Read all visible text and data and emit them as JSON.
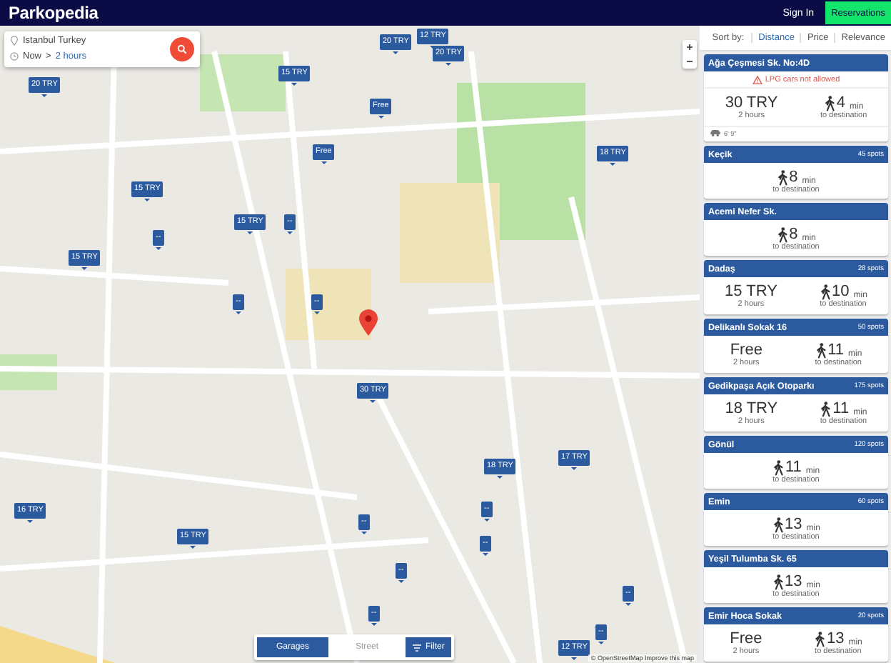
{
  "header": {
    "logo": "Parkopedia",
    "sign_in": "Sign In",
    "reservations": "Reservations"
  },
  "search": {
    "location": "Istanbul Turkey",
    "time": "Now",
    "separator": ">",
    "duration": "2 hours"
  },
  "map_pins": [
    {
      "label": "20 TRY"
    },
    {
      "label": "15 TRY"
    },
    {
      "label": "20 TRY"
    },
    {
      "label": "12 TRY"
    },
    {
      "label": "20 TRY"
    },
    {
      "label": "Free"
    },
    {
      "label": "Free"
    },
    {
      "label": "18 TRY"
    },
    {
      "label": "15 TRY"
    },
    {
      "label": "--"
    },
    {
      "label": "15 TRY"
    },
    {
      "label": "--"
    },
    {
      "label": "15 TRY"
    },
    {
      "label": "--"
    },
    {
      "label": "--"
    },
    {
      "label": "30 TRY"
    },
    {
      "label": "18 TRY"
    },
    {
      "label": "17 TRY"
    },
    {
      "label": "16 TRY"
    },
    {
      "label": "--"
    },
    {
      "label": "--"
    },
    {
      "label": "15 TRY"
    },
    {
      "label": "--"
    },
    {
      "label": "--"
    },
    {
      "label": "--"
    },
    {
      "label": "--"
    },
    {
      "label": "--"
    },
    {
      "label": "12 TRY"
    }
  ],
  "map_attribution": "© OpenStreetMap  Improve this map",
  "parking_filter": {
    "options": [
      {
        "label": "Garages",
        "selected": true
      },
      {
        "label": "Street",
        "selected": false
      }
    ],
    "filter": "Filter"
  },
  "sort": {
    "label": "Sort by:",
    "options": [
      {
        "label": "Distance",
        "selected": true
      },
      {
        "label": "Price",
        "selected": false
      },
      {
        "label": "Relevance",
        "selected": false
      }
    ]
  },
  "results": [
    {
      "name": "Ağa Çeşmesi Sk. No:4D",
      "warning": "LPG cars not allowed",
      "price": "30 TRY",
      "price_duration": "2 hours",
      "walk": "4",
      "walk_unit": "min",
      "walk_label": "to destination",
      "height": "6' 9\""
    },
    {
      "name": "Keçik",
      "spots": "45 spots",
      "walk": "8",
      "walk_unit": "min",
      "walk_label": "to destination"
    },
    {
      "name": "Acemi Nefer Sk.",
      "walk": "8",
      "walk_unit": "min",
      "walk_label": "to destination"
    },
    {
      "name": "Dadaş",
      "spots": "28 spots",
      "price": "15 TRY",
      "price_duration": "2 hours",
      "walk": "10",
      "walk_unit": "min",
      "walk_label": "to destination"
    },
    {
      "name": "Delikanlı Sokak 16",
      "spots": "50 spots",
      "price": "Free",
      "price_duration": "2 hours",
      "walk": "11",
      "walk_unit": "min",
      "walk_label": "to destination"
    },
    {
      "name": "Gedikpaşa Açık Otoparkı",
      "spots": "175 spots",
      "price": "18 TRY",
      "price_duration": "2 hours",
      "walk": "11",
      "walk_unit": "min",
      "walk_label": "to destination"
    },
    {
      "name": "Gönül",
      "spots": "120 spots",
      "walk": "11",
      "walk_unit": "min",
      "walk_label": "to destination"
    },
    {
      "name": "Emin",
      "spots": "60 spots",
      "walk": "13",
      "walk_unit": "min",
      "walk_label": "to destination"
    },
    {
      "name": "Yeşil Tulumba Sk. 65",
      "walk": "13",
      "walk_unit": "min",
      "walk_label": "to destination"
    },
    {
      "name": "Emir Hoca Sokak",
      "spots": "20 spots",
      "price": "Free",
      "price_duration": "2 hours",
      "walk": "13",
      "walk_unit": "min",
      "walk_label": "to destination"
    }
  ]
}
